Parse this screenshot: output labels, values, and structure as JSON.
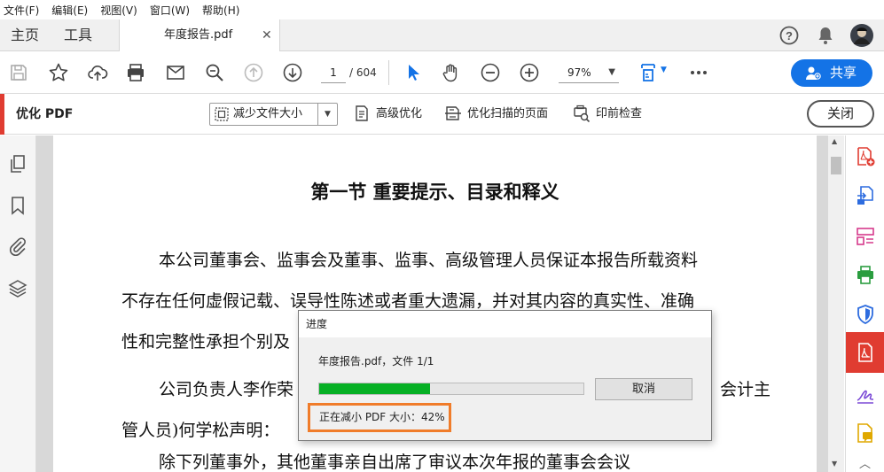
{
  "menu": [
    "文件(F)",
    "编辑(E)",
    "视图(V)",
    "窗口(W)",
    "帮助(H)"
  ],
  "tabs": {
    "home": "主页",
    "tools": "工具",
    "document": "年度报告.pdf"
  },
  "toolbar": {
    "page_current": "1",
    "page_total": "/ 604",
    "zoom": "97%",
    "share_label": "共享"
  },
  "optimize_bar": {
    "title": "优化 PDF",
    "reduce_label": "减少文件大小",
    "advanced_label": "高级优化",
    "optimize_scan_label": "优化扫描的页面",
    "preflight_label": "印前检查",
    "close_label": "关闭"
  },
  "document": {
    "heading": "第一节  重要提示、目录和释义",
    "lines": [
      "本公司董事会、监事会及董事、监事、高级管理人员保证本报告所载资料",
      "不存在任何虚假记载、误导性陈述或者重大遗漏，并对其内容的真实性、准确",
      "性和完整性承担个别及",
      "公司负责人李作荣",
      "会计主",
      "管人员)何学松声明：",
      "除下列董事外，其他董事亲自出席了审议本次年报的董事会会议"
    ]
  },
  "dialog": {
    "title": "进度",
    "file_line": "年度报告.pdf，文件 1/1",
    "progress": 0.42,
    "cancel_label": "取消",
    "status": "正在减小 PDF 大小：42%"
  },
  "colors": {
    "accent_blue": "#1473e6",
    "accent_red": "#e03c31",
    "progress_green": "#06b025",
    "highlight_orange": "#f07c2a"
  }
}
